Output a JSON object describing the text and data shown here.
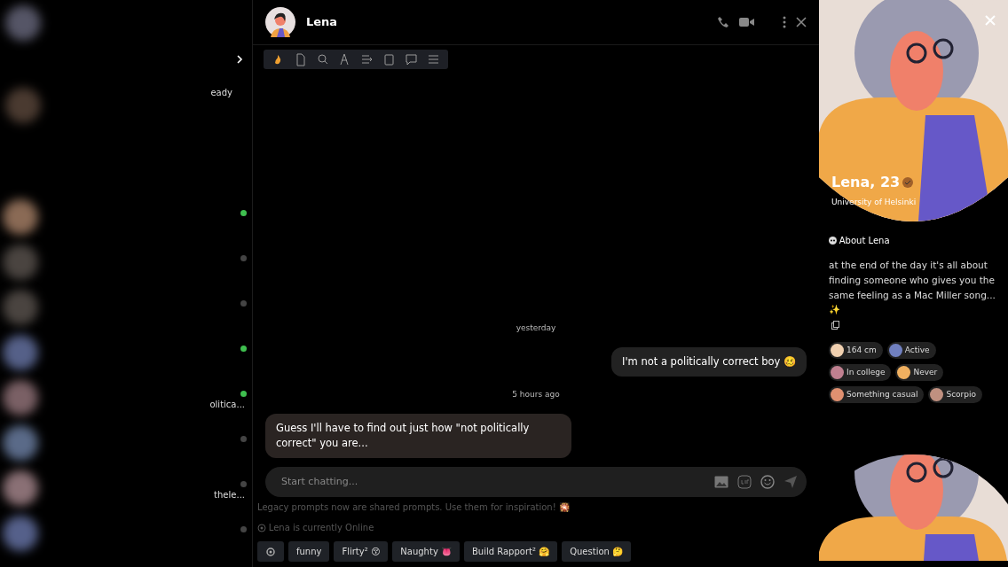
{
  "sidebar": {
    "pinned_preview": "eady",
    "conversations": [
      {
        "online": true
      },
      {
        "online": false
      },
      {
        "online": false
      },
      {
        "online": true
      },
      {
        "online": true,
        "snippet": "olitica..."
      },
      {
        "online": false
      },
      {
        "online": false,
        "snippet": "thele..."
      },
      {
        "online": false
      }
    ]
  },
  "chat": {
    "title": "Lena",
    "messages": [
      {
        "kind": "divider",
        "text": "yesterday"
      },
      {
        "kind": "outgoing",
        "text": "I'm not a politically correct boy 🥴"
      },
      {
        "kind": "divider",
        "text": "5 hours ago"
      },
      {
        "kind": "incoming",
        "text": "Guess I'll have to find out just how \"not politically correct\" you are..."
      }
    ],
    "input": {
      "placeholder": "Start chatting..."
    },
    "notice": "Legacy prompts now are shared prompts. Use them for inspiration! 🎇",
    "status": "Lena is currently Online",
    "prompts": [
      "funny",
      "Flirty² 😚",
      "Naughty 👅",
      "Build Rapport² 🤗",
      "Question 🤔"
    ]
  },
  "profile": {
    "name": "Lena, 23",
    "school": "University of Helsinki",
    "about_title": "About Lena",
    "bio": "at the end of the day it's all about finding someone who gives you the same feeling as a Mac Miller song... ✨",
    "tags": [
      "164 cm",
      "Active",
      "In college",
      "Never",
      "Something casual",
      "Scorpio"
    ]
  }
}
